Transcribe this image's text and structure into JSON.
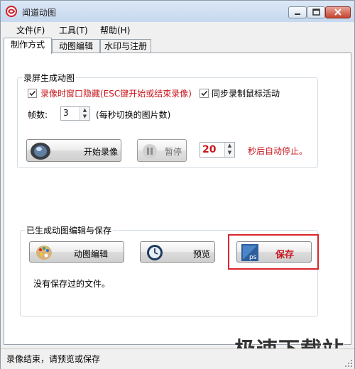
{
  "window": {
    "title": "闻道动图"
  },
  "menu": [
    "文件(F)",
    "工具(T)",
    "帮助(H)"
  ],
  "tabs": [
    "制作方式",
    "动图编辑",
    "水印与注册"
  ],
  "record_group": {
    "title": "录屏生成动图",
    "hide_window_checkbox": {
      "label": "录像时窗口隐藏(ESC键开始或结束录像)",
      "checked": true
    },
    "sync_mouse_checkbox": {
      "label": "同步录制鼠标活动",
      "checked": true
    },
    "fps_label": "帧数:",
    "fps_value": "3",
    "fps_hint": "(每秒切换的图片数)",
    "start_button": "开始录像",
    "pause_button": "暂停",
    "auto_stop_value": "20",
    "auto_stop_label": "秒后自动停止。"
  },
  "edit_group": {
    "title": "已生成动图编辑与保存",
    "edit_button": "动图编辑",
    "preview_button": "预览",
    "save_button": "保存",
    "status_text": "没有保存过的文件。"
  },
  "statusbar": {
    "text": "录像结束，请预览或保存"
  },
  "watermark": "极速下载站",
  "colors": {
    "accent_red": "#c8171e",
    "highlight_border": "#d9262c"
  },
  "icons": [
    "app-logo-icon",
    "camera-lens-icon",
    "pause-icon",
    "palette-icon",
    "clock-icon",
    "photoshop-icon"
  ]
}
